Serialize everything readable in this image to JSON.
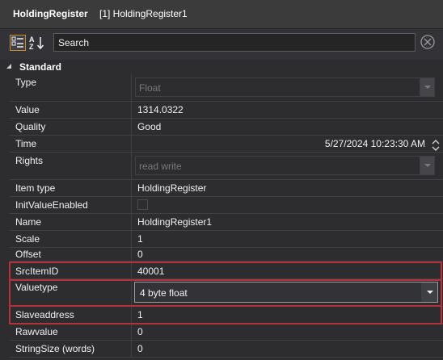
{
  "header": {
    "item_type": "HoldingRegister",
    "item_name": "[1] HoldingRegister1"
  },
  "toolbar": {
    "categorized_icon": "categorized-icon",
    "alphabetical_icon": "alphabetical-sort-icon",
    "search_value": "Search",
    "clear_icon": "clear-search-icon"
  },
  "category": {
    "label": "Standard"
  },
  "properties": {
    "type": {
      "label": "Type",
      "value": "Float"
    },
    "value": {
      "label": "Value",
      "value": "1314.0322"
    },
    "quality": {
      "label": "Quality",
      "value": "Good"
    },
    "time": {
      "label": "Time",
      "value": "5/27/2024 10:23:30 AM"
    },
    "rights": {
      "label": "Rights",
      "value": "read write"
    },
    "item_type": {
      "label": "Item type",
      "value": "HoldingRegister"
    },
    "init_value_enabled": {
      "label": "InitValueEnabled",
      "checked": false
    },
    "name": {
      "label": "Name",
      "value": "HoldingRegister1"
    },
    "scale": {
      "label": "Scale",
      "value": "1"
    },
    "offset": {
      "label": "Offset",
      "value": "0"
    },
    "src_item_id": {
      "label": "SrcItemID",
      "value": "40001"
    },
    "valuetype": {
      "label": "Valuetype",
      "value": "4 byte float"
    },
    "slaveaddress": {
      "label": "Slaveaddress",
      "value": "1"
    },
    "rawvalue": {
      "label": "Rawvalue",
      "value": "0"
    },
    "string_size": {
      "label": "StringSize (words)",
      "value": "0"
    }
  },
  "colors": {
    "highlight": "#b7303a",
    "background": "#2d2d30",
    "accent": "#d08a2e"
  }
}
